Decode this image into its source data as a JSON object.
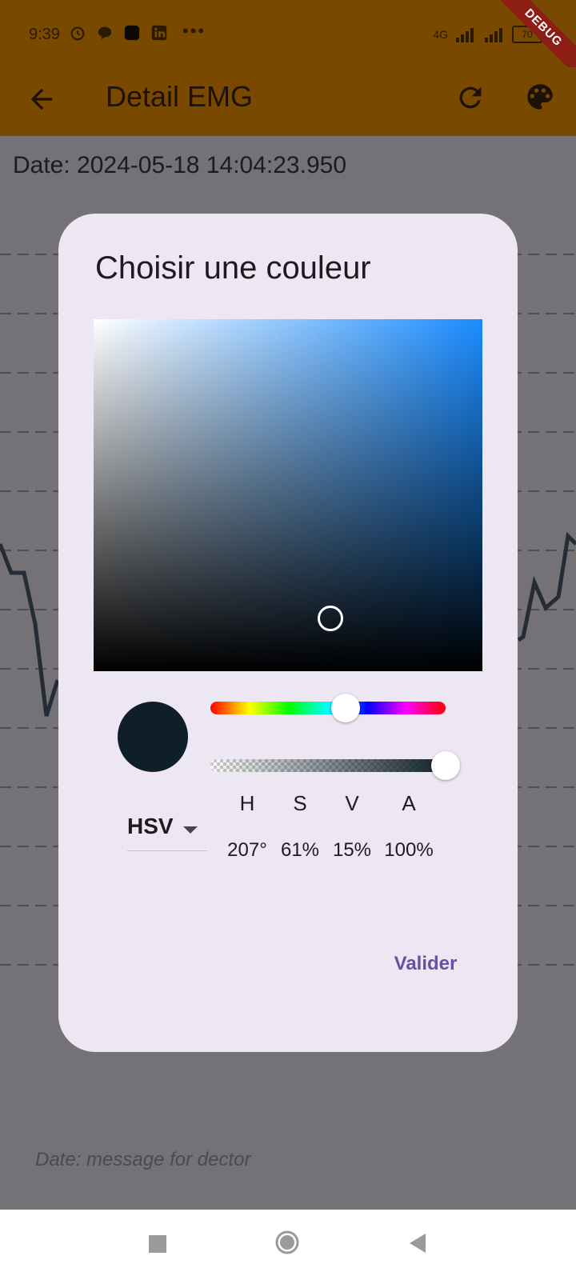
{
  "status_bar": {
    "time": "9:39",
    "network": "4G",
    "battery": "70",
    "icons": [
      "alarm-icon",
      "chat-icon",
      "app-icon",
      "linkedin-icon",
      "more-icon"
    ]
  },
  "debug_banner": "DEBUG",
  "app_bar": {
    "title": "Detail EMG",
    "back_icon": "arrow-back-icon",
    "actions": [
      "refresh-icon",
      "palette-icon"
    ],
    "color": "#7a4900"
  },
  "content": {
    "date_text": "Date: 2024-05-18 14:04:23.950",
    "note_text": "Date: message for dector"
  },
  "dialog": {
    "title": "Choisir une couleur",
    "color_mode": "HSV",
    "channels": [
      {
        "label": "H",
        "value": "207°"
      },
      {
        "label": "S",
        "value": "61%"
      },
      {
        "label": "V",
        "value": "15%"
      },
      {
        "label": "A",
        "value": "100%"
      }
    ],
    "hue": 207,
    "saturation": 0.61,
    "value_brightness": 0.15,
    "alpha": 1.0,
    "selected_color": "#0f1f29",
    "confirm_label": "Valider",
    "accent_color": "#6750a4"
  },
  "nav_bar": {
    "items": [
      "recents-icon",
      "home-icon",
      "back-icon"
    ]
  }
}
